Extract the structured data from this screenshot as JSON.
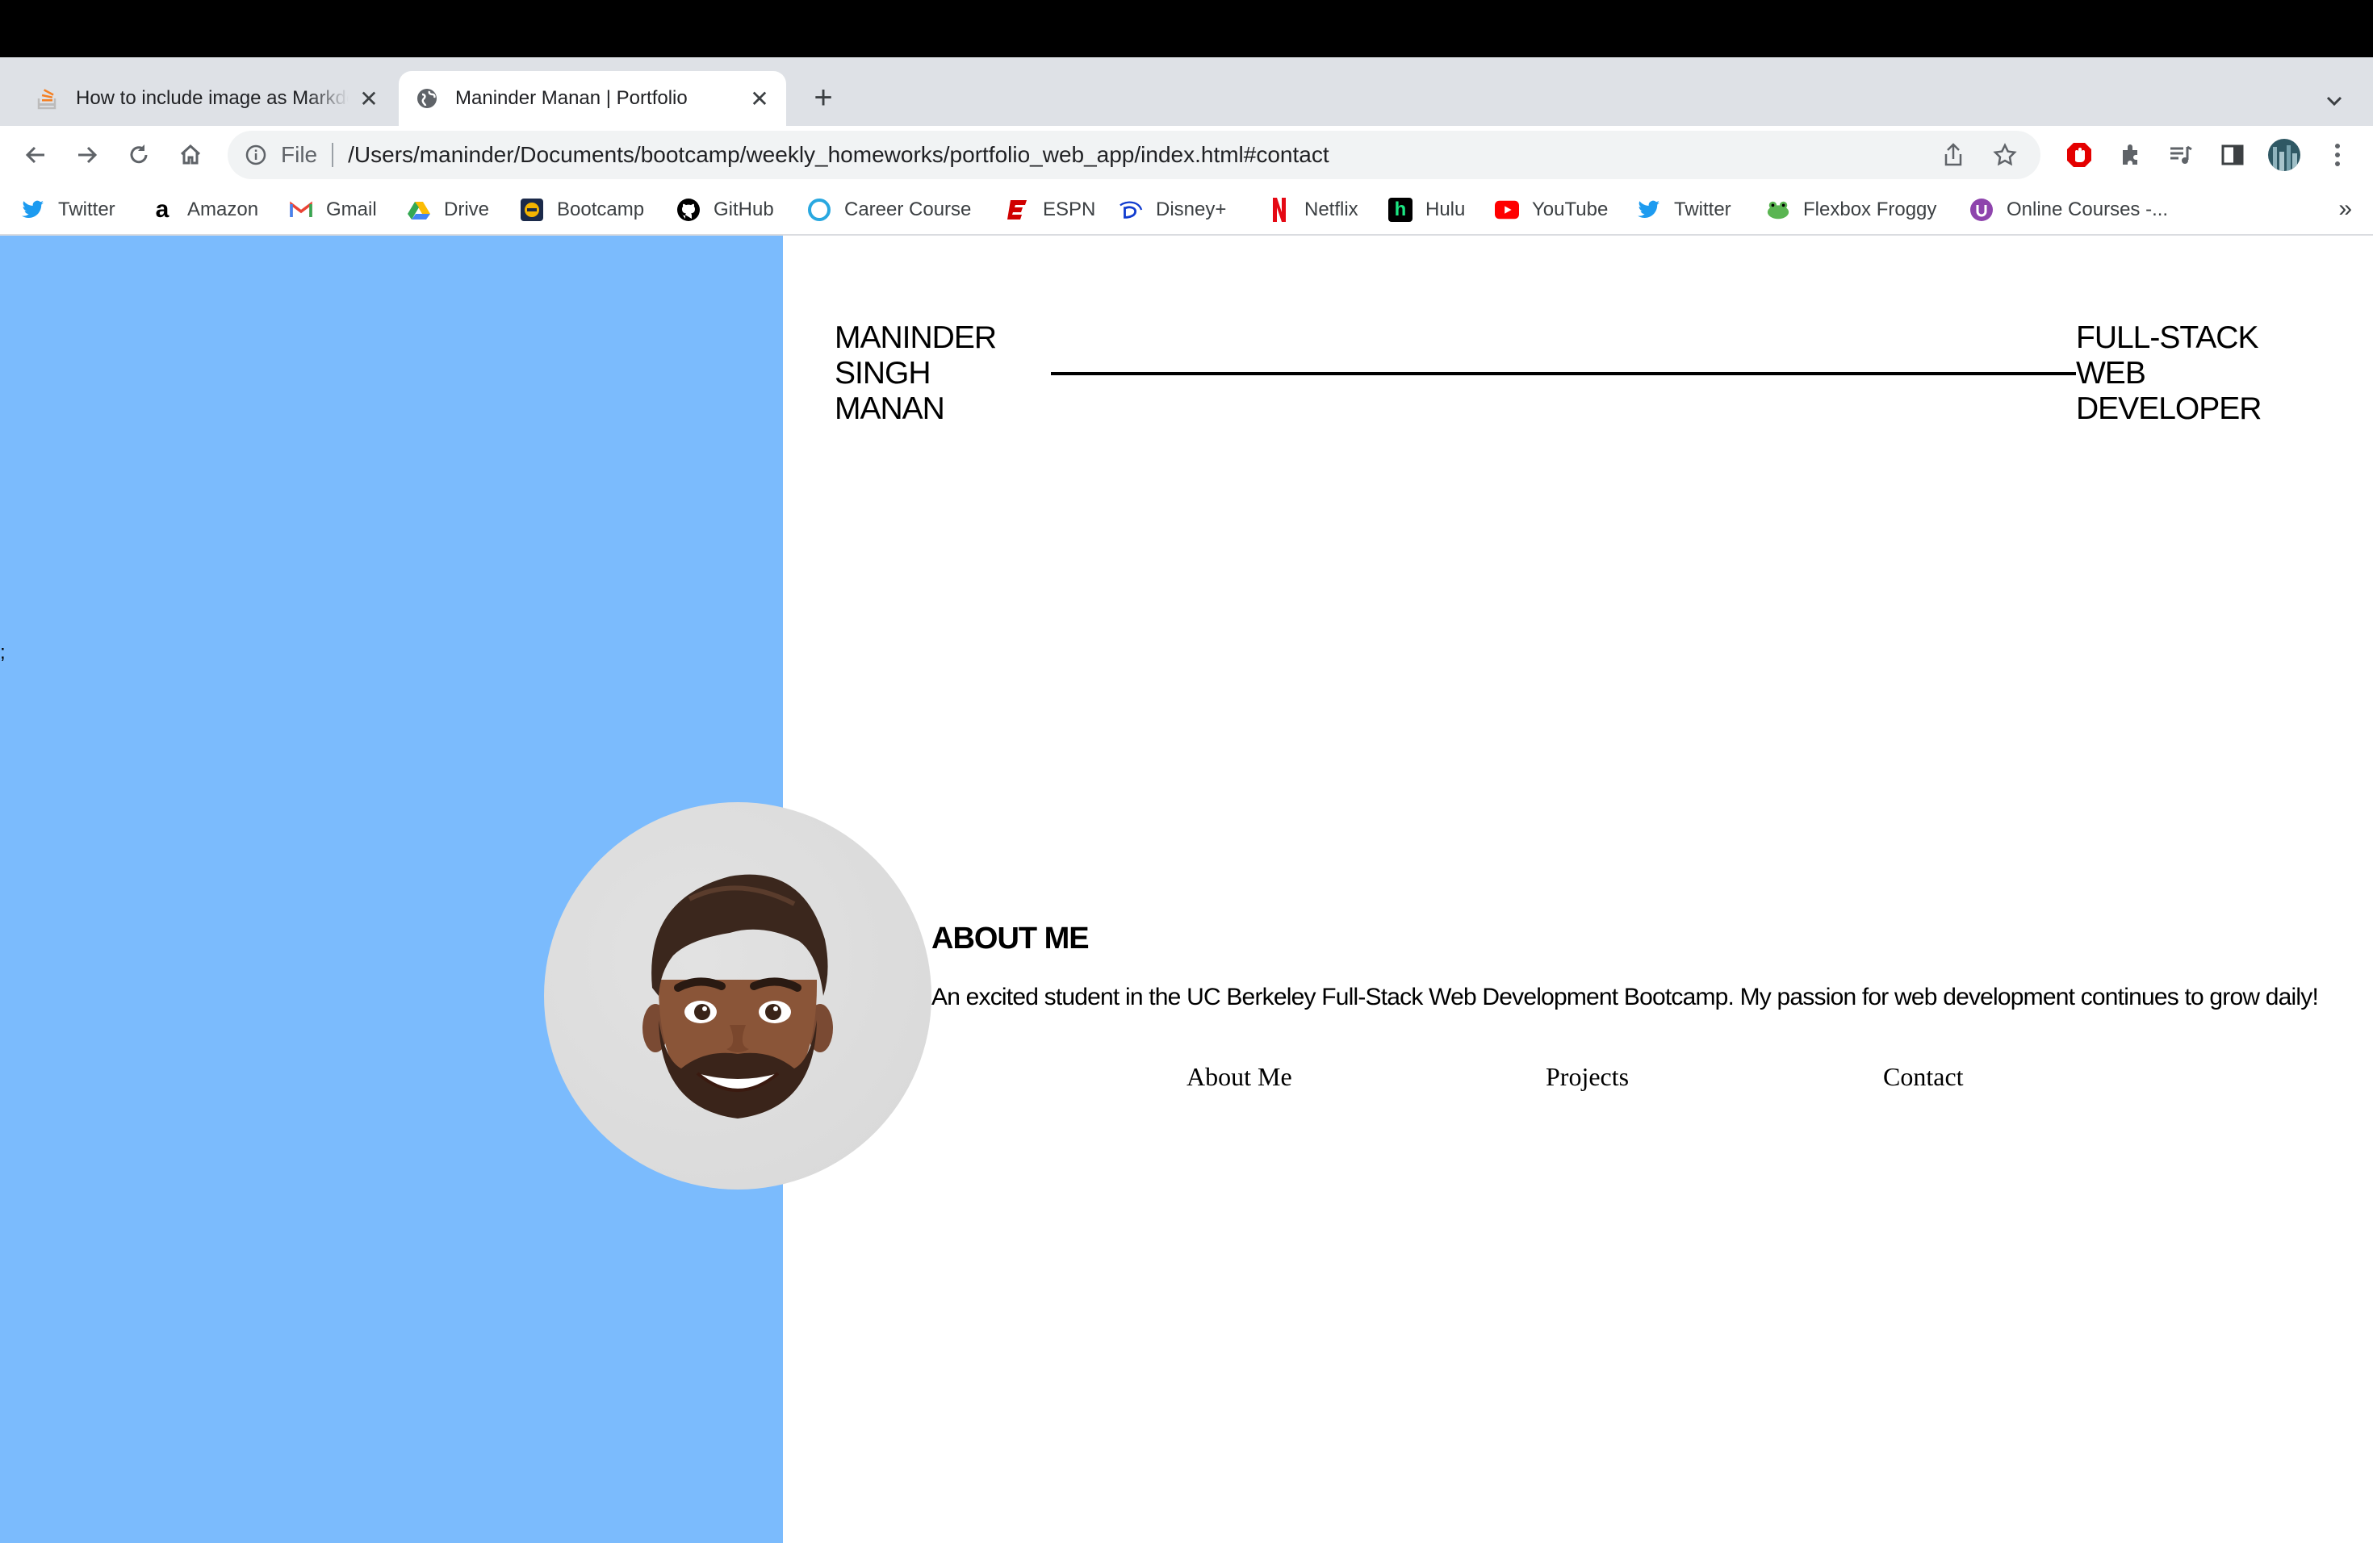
{
  "browser": {
    "tabs": [
      {
        "title": "How to include image as Markdown",
        "favicon": "stackoverflow-icon",
        "active": false
      },
      {
        "title": "Maninder Manan | Portfolio",
        "favicon": "globe-icon",
        "active": true
      }
    ],
    "omnibox": {
      "scheme": "File",
      "url": "/Users/maninder/Documents/bootcamp/weekly_homeworks/portfolio_web_app/index.html#contact"
    },
    "bookmarks": [
      {
        "label": "Twitter",
        "icon": "twitter-icon",
        "color": "#1d9bf0"
      },
      {
        "label": "Amazon",
        "icon": "amazon-icon",
        "color": "#000000"
      },
      {
        "label": "Gmail",
        "icon": "gmail-icon",
        "color": "#ea4335"
      },
      {
        "label": "Drive",
        "icon": "drive-icon",
        "color": "#34a853"
      },
      {
        "label": "Bootcamp",
        "icon": "bootcamp-icon",
        "color": "#f4b400"
      },
      {
        "label": "GitHub",
        "icon": "github-icon",
        "color": "#000000"
      },
      {
        "label": "Career Course",
        "icon": "career-course-icon",
        "color": "#29a8e0"
      },
      {
        "label": "ESPN",
        "icon": "espn-icon",
        "color": "#d00000"
      },
      {
        "label": "Disney+",
        "icon": "disney-icon",
        "color": "#113ccf"
      },
      {
        "label": "Netflix",
        "icon": "netflix-icon",
        "color": "#e50914"
      },
      {
        "label": "Hulu",
        "icon": "hulu-icon",
        "color": "#1ce783"
      },
      {
        "label": "YouTube",
        "icon": "youtube-icon",
        "color": "#ff0000"
      },
      {
        "label": "Twitter",
        "icon": "twitter-icon",
        "color": "#1d9bf0"
      },
      {
        "label": "Flexbox Froggy",
        "icon": "frog-icon",
        "color": "#5ab552"
      },
      {
        "label": "Online Courses -...",
        "icon": "online-courses-icon",
        "color": "#8e44ad"
      }
    ]
  },
  "page": {
    "stray_char": ";",
    "brand_name": "MANINDER\nSINGH MANAN",
    "brand_role": "FULL-STACK WEB\nDEVELOPER",
    "about_heading": "ABOUT ME",
    "about_text": "An excited student in the UC Berkeley Full-Stack Web Development Bootcamp. My passion for web development continues to grow daily!",
    "nav": [
      {
        "label": "About Me"
      },
      {
        "label": "Projects"
      },
      {
        "label": "Contact"
      }
    ],
    "colors": {
      "left_panel": "#7bbbfd",
      "avatar_bg": "#e0e0e0"
    }
  }
}
